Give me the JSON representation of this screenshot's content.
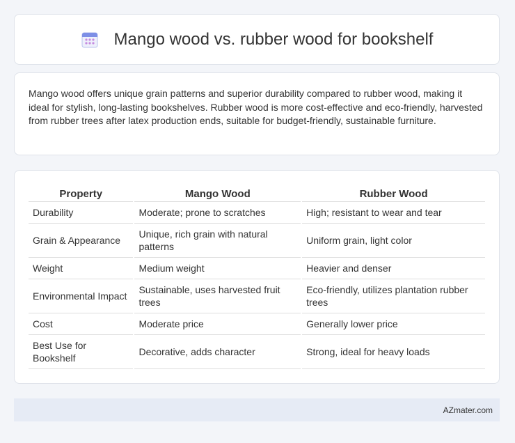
{
  "header": {
    "title": "Mango wood vs. rubber wood for bookshelf",
    "icon": "calendar-icon"
  },
  "summary": {
    "text": "Mango wood offers unique grain patterns and superior durability compared to rubber wood, making it ideal for stylish, long-lasting bookshelves. Rubber wood is more cost-effective and eco-friendly, harvested from rubber trees after latex production ends, suitable for budget-friendly, sustainable furniture."
  },
  "table": {
    "headers": [
      "Property",
      "Mango Wood",
      "Rubber Wood"
    ],
    "rows": [
      [
        "Durability",
        "Moderate; prone to scratches",
        "High; resistant to wear and tear"
      ],
      [
        "Grain & Appearance",
        "Unique, rich grain with natural patterns",
        "Uniform grain, light color"
      ],
      [
        "Weight",
        "Medium weight",
        "Heavier and denser"
      ],
      [
        "Environmental Impact",
        "Sustainable, uses harvested fruit trees",
        "Eco-friendly, utilizes plantation rubber trees"
      ],
      [
        "Cost",
        "Moderate price",
        "Generally lower price"
      ],
      [
        "Best Use for Bookshelf",
        "Decorative, adds character",
        "Strong, ideal for heavy loads"
      ]
    ]
  },
  "footer": {
    "brand": "AZmater.com"
  },
  "colors": {
    "background": "#f3f5f9",
    "card": "#ffffff",
    "footer": "#e6ebf5"
  }
}
